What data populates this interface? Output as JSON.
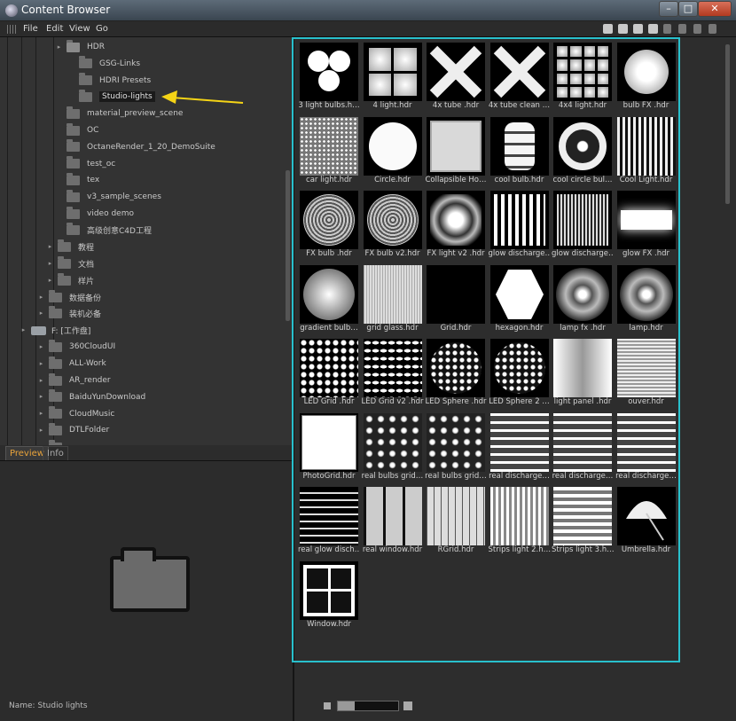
{
  "window": {
    "title": "Content Browser",
    "min": "–",
    "max": "□",
    "close": "✕"
  },
  "menu": [
    "File",
    "Edit",
    "View",
    "Go"
  ],
  "toolbar_icons": [
    "new-folder-icon",
    "save-icon",
    "lock-icon",
    "home-icon",
    "back-icon",
    "forward-icon",
    "up-icon",
    "search-icon"
  ],
  "tree": [
    {
      "label": "HDR",
      "depth": 4,
      "open": true,
      "type": "folder"
    },
    {
      "label": "GSG-Links",
      "depth": 5,
      "type": "folder"
    },
    {
      "label": "HDRI Presets",
      "depth": 5,
      "type": "folder"
    },
    {
      "label": "Studio-lights",
      "depth": 5,
      "type": "folder",
      "selected": true
    },
    {
      "label": "material_preview_scene",
      "depth": 4,
      "type": "folder"
    },
    {
      "label": "OC",
      "depth": 4,
      "type": "folder"
    },
    {
      "label": "OctaneRender_1_20_DemoSuite",
      "depth": 4,
      "type": "folder"
    },
    {
      "label": "test_oc",
      "depth": 4,
      "type": "folder"
    },
    {
      "label": "tex",
      "depth": 4,
      "type": "folder"
    },
    {
      "label": "v3_sample_scenes",
      "depth": 4,
      "type": "folder"
    },
    {
      "label": "video demo",
      "depth": 4,
      "type": "folder"
    },
    {
      "label": "高级创意C4D工程",
      "depth": 4,
      "type": "folder"
    },
    {
      "label": "教程",
      "depth": 3,
      "type": "folder"
    },
    {
      "label": "文档",
      "depth": 3,
      "type": "folder"
    },
    {
      "label": "样片",
      "depth": 3,
      "type": "folder"
    },
    {
      "label": "数据备份",
      "depth": 2,
      "type": "folder"
    },
    {
      "label": "装机必备",
      "depth": 2,
      "type": "folder"
    },
    {
      "label": "F: [工作盘]",
      "depth": 1,
      "type": "drive"
    },
    {
      "label": "360CloudUI",
      "depth": 2,
      "type": "folder"
    },
    {
      "label": "ALL-Work",
      "depth": 2,
      "type": "folder"
    },
    {
      "label": "AR_render",
      "depth": 2,
      "type": "folder"
    },
    {
      "label": "BaiduYunDownload",
      "depth": 2,
      "type": "folder"
    },
    {
      "label": "CloudMusic",
      "depth": 2,
      "type": "folder"
    },
    {
      "label": "DTLFolder",
      "depth": 2,
      "type": "folder"
    },
    {
      "label": "",
      "depth": 2,
      "type": "folder"
    }
  ],
  "tabs": {
    "preview": "Preview",
    "info": "Info"
  },
  "status": {
    "name": "Name: Studio lights"
  },
  "zoom": {
    "level": 0.28
  },
  "files": [
    {
      "name": "3 light bulbs.h…",
      "pattern": "three-dots"
    },
    {
      "name": "4 light.hdr",
      "pattern": "four-soft"
    },
    {
      "name": "4x tube .hdr",
      "pattern": "x-cross"
    },
    {
      "name": "4x tube clean …",
      "pattern": "x-cross"
    },
    {
      "name": "4x4 light.hdr",
      "pattern": "grid4"
    },
    {
      "name": "bulb FX .hdr",
      "pattern": "bulb"
    },
    {
      "name": "car light.hdr",
      "pattern": "dotfield"
    },
    {
      "name": "Circle.hdr",
      "pattern": "circle"
    },
    {
      "name": "Collapsible Ho…",
      "pattern": "softbox"
    },
    {
      "name": "cool bulb.hdr",
      "pattern": "coil"
    },
    {
      "name": "cool circle bul…",
      "pattern": "ring"
    },
    {
      "name": "Cool Light.hdr",
      "pattern": "bars-tiled"
    },
    {
      "name": "FX bulb .hdr",
      "pattern": "radial"
    },
    {
      "name": "FX bulb v2.hdr",
      "pattern": "radial"
    },
    {
      "name": "FX light v2 .hdr",
      "pattern": "lens"
    },
    {
      "name": "glow discharge…",
      "pattern": "vbars"
    },
    {
      "name": "glow discharge…",
      "pattern": "vbars-fine"
    },
    {
      "name": "glow FX .hdr",
      "pattern": "hglow"
    },
    {
      "name": "gradient bulb…",
      "pattern": "sphere"
    },
    {
      "name": "grid glass.hdr",
      "pattern": "fine-grid"
    },
    {
      "name": "Grid.hdr",
      "pattern": "grid-lines"
    },
    {
      "name": "hexagon.hdr",
      "pattern": "hexagon"
    },
    {
      "name": "lamp fx .hdr",
      "pattern": "lamp"
    },
    {
      "name": "lamp.hdr",
      "pattern": "lamp"
    },
    {
      "name": "LED Grid .hdr",
      "pattern": "led"
    },
    {
      "name": "LED Grid v2 .hdr",
      "pattern": "led-h"
    },
    {
      "name": "LED Sphere .hdr",
      "pattern": "led-round"
    },
    {
      "name": "LED Sphere 2 …",
      "pattern": "led-round"
    },
    {
      "name": "light panel .hdr",
      "pattern": "panel"
    },
    {
      "name": "ouver.hdr",
      "pattern": "louver"
    },
    {
      "name": "PhotoGrid.hdr",
      "pattern": "photo-grid"
    },
    {
      "name": "real bulbs grid…",
      "pattern": "bulbs-grid"
    },
    {
      "name": "real bulbs grid…",
      "pattern": "bulbs-grid"
    },
    {
      "name": "real discharge…",
      "pattern": "streaks"
    },
    {
      "name": "real discharge…",
      "pattern": "streaks"
    },
    {
      "name": "real discharge…",
      "pattern": "streaks"
    },
    {
      "name": "real glow disch…",
      "pattern": "hbars"
    },
    {
      "name": "real window.hdr",
      "pattern": "window"
    },
    {
      "name": "RGrid.hdr",
      "pattern": "rgrid"
    },
    {
      "name": "Strips light 2.h…",
      "pattern": "strips-v"
    },
    {
      "name": "Strips light 3.h…",
      "pattern": "strips-h"
    },
    {
      "name": "Umbrella.hdr",
      "pattern": "umbrella"
    },
    {
      "name": "Window.hdr",
      "pattern": "window4"
    }
  ],
  "colors": {
    "highlight": "#29c0cc",
    "arrow": "#f5d416",
    "tab_active": "#e8a33b"
  }
}
